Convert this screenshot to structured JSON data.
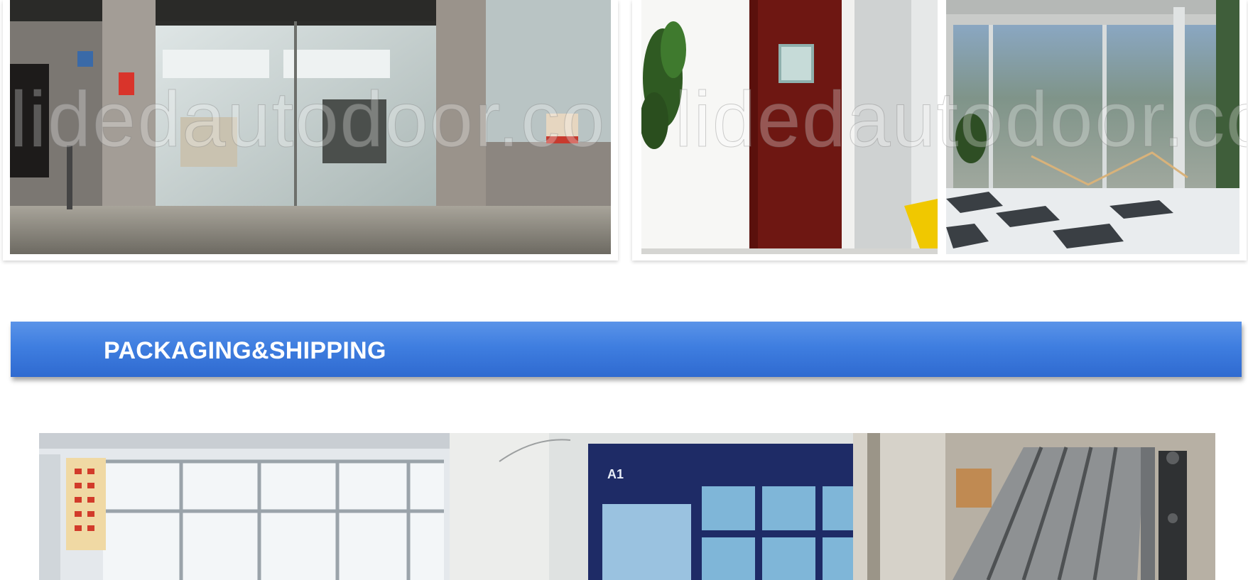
{
  "gallery_top": {
    "left_card": {
      "watermark": "lidedautodoor.com"
    },
    "right_card": {
      "watermark": "lidedautodoor.com"
    }
  },
  "section": {
    "title": "PACKAGING&SHIPPING",
    "colors": {
      "banner_top": "#5a93e8",
      "banner_bottom": "#2f6ad0",
      "title": "#ffffff"
    }
  },
  "gallery_bottom": {
    "panel_2_label": "A1"
  }
}
